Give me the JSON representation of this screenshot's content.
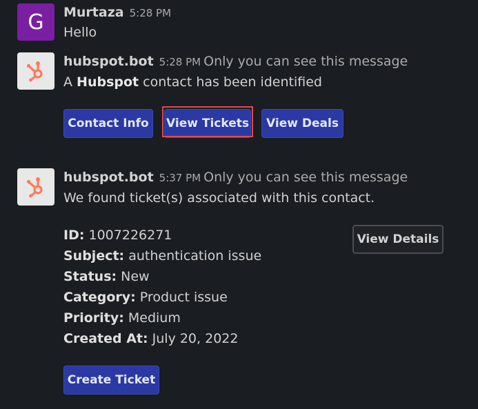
{
  "messages": [
    {
      "avatar_letter": "G",
      "name": "Murtaza",
      "time": "5:28 PM",
      "text": "Hello"
    },
    {
      "name": "hubspot.bot",
      "time": "5:28 PM",
      "note": "Only you can see this message",
      "text_prefix": "A",
      "text_bold": "Hubspot",
      "text_suffix": "contact has been identified",
      "buttons": [
        "Contact Info",
        "View Tickets",
        "View Deals"
      ]
    },
    {
      "name": "hubspot.bot",
      "time": "5:37 PM",
      "note": "Only you can see this message",
      "text": "We found ticket(s) associated with this contact.",
      "fields": [
        {
          "key": "ID:",
          "value": "1007226271"
        },
        {
          "key": "Subject:",
          "value": "authentication issue"
        },
        {
          "key": "Status:",
          "value": "New"
        },
        {
          "key": "Category:",
          "value": "Product issue"
        },
        {
          "key": "Priority:",
          "value": "Medium"
        },
        {
          "key": "Created At:",
          "value": "July 20, 2022"
        }
      ],
      "view_details": "View Details",
      "create_ticket": "Create Ticket"
    }
  ],
  "colors": {
    "background": "#1a1d21",
    "button_primary": "#2a39a3",
    "avatar_purple": "#7a1fa2",
    "hubspot_orange": "#ff7a59",
    "highlight": "#e04a4a"
  },
  "icons": {
    "hubspot_avatar": "hubspot-sprocket-icon"
  }
}
